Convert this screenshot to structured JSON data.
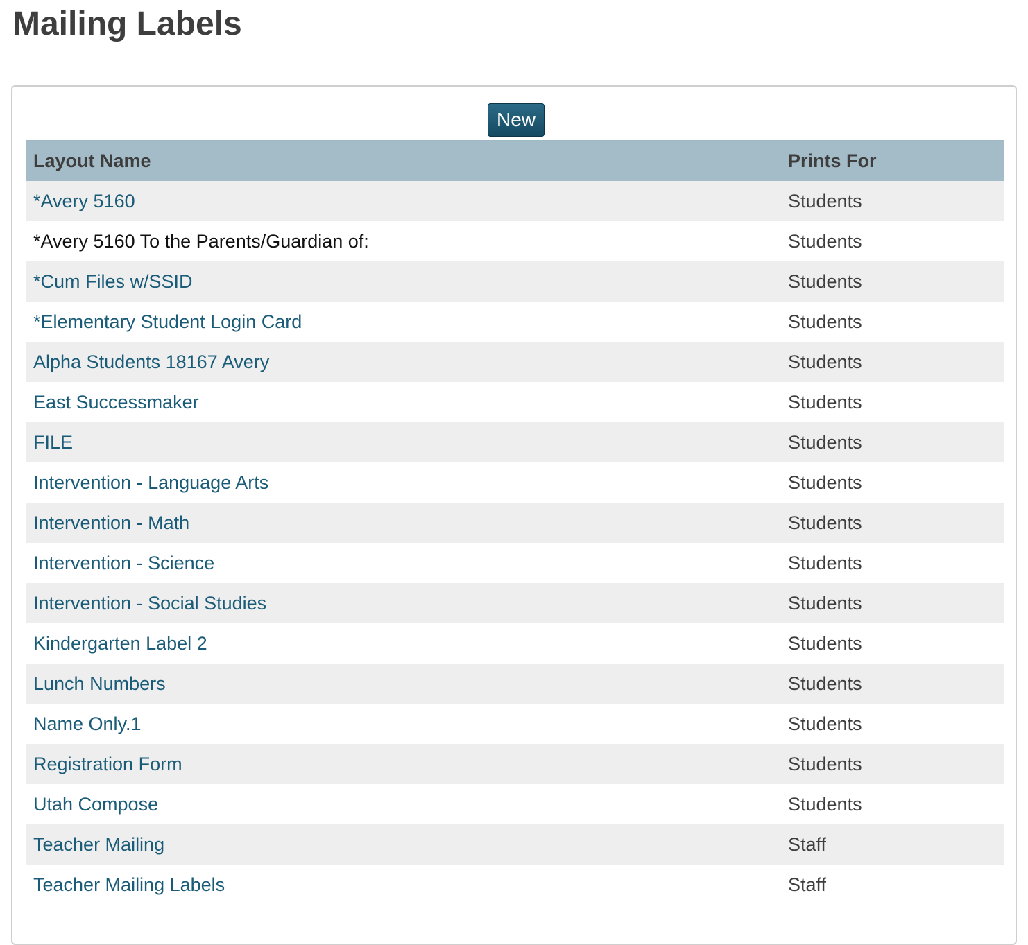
{
  "page": {
    "title": "Mailing Labels"
  },
  "toolbar": {
    "new_label": "New"
  },
  "table": {
    "columns": [
      "Layout Name",
      "Prints For"
    ],
    "rows": [
      {
        "name": "*Avery 5160",
        "prints_for": "Students",
        "link": true
      },
      {
        "name": "*Avery 5160 To the Parents/Guardian of:",
        "prints_for": "Students",
        "link": false
      },
      {
        "name": "*Cum Files w/SSID",
        "prints_for": "Students",
        "link": true
      },
      {
        "name": "*Elementary Student Login Card",
        "prints_for": "Students",
        "link": true
      },
      {
        "name": "Alpha Students 18167 Avery",
        "prints_for": "Students",
        "link": true
      },
      {
        "name": "East Successmaker",
        "prints_for": "Students",
        "link": true
      },
      {
        "name": "FILE",
        "prints_for": "Students",
        "link": true
      },
      {
        "name": "Intervention - Language Arts",
        "prints_for": "Students",
        "link": true
      },
      {
        "name": "Intervention - Math",
        "prints_for": "Students",
        "link": true
      },
      {
        "name": "Intervention - Science",
        "prints_for": "Students",
        "link": true
      },
      {
        "name": "Intervention - Social Studies",
        "prints_for": "Students",
        "link": true
      },
      {
        "name": "Kindergarten Label 2",
        "prints_for": "Students",
        "link": true
      },
      {
        "name": "Lunch Numbers",
        "prints_for": "Students",
        "link": true
      },
      {
        "name": "Name Only.1",
        "prints_for": "Students",
        "link": true
      },
      {
        "name": "Registration Form",
        "prints_for": "Students",
        "link": true
      },
      {
        "name": "Utah Compose",
        "prints_for": "Students",
        "link": true
      },
      {
        "name": "Teacher Mailing",
        "prints_for": "Staff",
        "link": true
      },
      {
        "name": "Teacher Mailing Labels",
        "prints_for": "Staff",
        "link": true
      }
    ]
  },
  "colors": {
    "link": "#1a5c78",
    "header_bg": "#a4bcc8",
    "button_bg": "#1f5a74",
    "stripe": "#eeeeee"
  }
}
